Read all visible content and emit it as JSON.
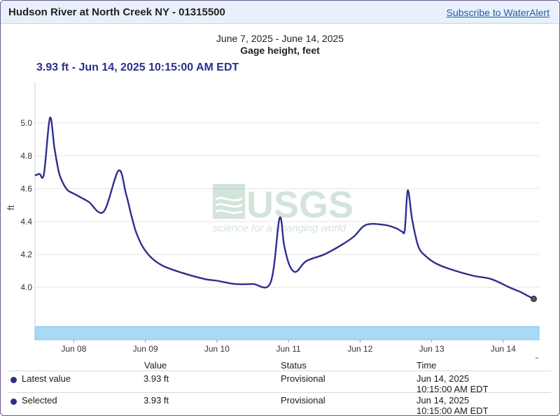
{
  "header": {
    "site_title": "Hudson River at North Creek NY - 01315500",
    "subscribe_label": "Subscribe to WaterAlert"
  },
  "tooltip": "3.93 ft - Jun 14, 2025 10:15:00 AM EDT",
  "watermark": {
    "logo": "USGS",
    "tagline": "science for a changing world"
  },
  "legend": {
    "headers": {
      "value": "Value",
      "status": "Status",
      "time": "Time"
    },
    "rows": [
      {
        "name": "Latest value",
        "value": "3.93 ft",
        "status": "Provisional",
        "time_line1": "Jun 14, 2025",
        "time_line2": "10:15:00 AM EDT"
      },
      {
        "name": "Selected",
        "value": "3.93 ft",
        "status": "Provisional",
        "time_line1": "Jun 14, 2025",
        "time_line2": "10:15:00 AM EDT"
      }
    ]
  },
  "colors": {
    "line": "#2e2e8f",
    "navigator": "#a9d9f5",
    "header_bg": "#e8f0fb",
    "grid": "#e3e3e3"
  },
  "chart_data": {
    "type": "line",
    "title": "June 7, 2025 - June 14, 2025",
    "subtitle": "Gage height, feet",
    "xlabel": "",
    "ylabel": "ft",
    "x_ticks": [
      "Jun 08",
      "Jun 09",
      "Jun 10",
      "Jun 11",
      "Jun 12",
      "Jun 13",
      "Jun 14"
    ],
    "y_ticks": [
      "4.0",
      "4.2",
      "4.4",
      "4.6",
      "4.8",
      "5.0"
    ],
    "ylim": [
      3.77,
      5.25
    ],
    "xlim": [
      "2025-06-07 11:00",
      "2025-06-14 12:00"
    ],
    "grid": true,
    "series": [
      {
        "name": "",
        "x": [
          "2025-06-07 11:00",
          "2025-06-07 12:30",
          "2025-06-07 14:00",
          "2025-06-07 16:00",
          "2025-06-07 17:30",
          "2025-06-07 19:00",
          "2025-06-07 20:30",
          "2025-06-07 22:00",
          "2025-06-08 00:00",
          "2025-06-08 02:00",
          "2025-06-08 05:00",
          "2025-06-08 10:00",
          "2025-06-08 15:00",
          "2025-06-08 17:30",
          "2025-06-08 19:00",
          "2025-06-08 20:00",
          "2025-06-08 21:00",
          "2025-06-08 23:00",
          "2025-06-09 02:00",
          "2025-06-09 06:00",
          "2025-06-09 12:00",
          "2025-06-09 20:00",
          "2025-06-10 00:00",
          "2025-06-10 06:00",
          "2025-06-10 12:00",
          "2025-06-10 18:00",
          "2025-06-10 21:00",
          "2025-06-10 22:30",
          "2025-06-11 00:00",
          "2025-06-11 01:30",
          "2025-06-11 03:00",
          "2025-06-11 06:00",
          "2025-06-11 12:00",
          "2025-06-11 18:00",
          "2025-06-11 22:00",
          "2025-06-12 02:00",
          "2025-06-12 08:00",
          "2025-06-12 12:00",
          "2025-06-12 14:00",
          "2025-06-12 15:00",
          "2025-06-12 16:00",
          "2025-06-12 17:30",
          "2025-06-12 19:30",
          "2025-06-12 22:00",
          "2025-06-13 02:00",
          "2025-06-13 08:00",
          "2025-06-13 14:00",
          "2025-06-13 20:00",
          "2025-06-14 02:00",
          "2025-06-14 06:00",
          "2025-06-14 08:00",
          "2025-06-14 10:15"
        ],
        "y": [
          4.68,
          4.69,
          4.69,
          5.03,
          4.85,
          4.7,
          4.63,
          4.59,
          4.57,
          4.55,
          4.52,
          4.46,
          4.71,
          4.57,
          4.46,
          4.39,
          4.33,
          4.25,
          4.18,
          4.13,
          4.09,
          4.05,
          4.04,
          4.02,
          4.02,
          4.03,
          4.42,
          4.26,
          4.15,
          4.1,
          4.1,
          4.16,
          4.2,
          4.26,
          4.31,
          4.38,
          4.38,
          4.36,
          4.34,
          4.35,
          4.59,
          4.41,
          4.25,
          4.19,
          4.14,
          4.1,
          4.07,
          4.05,
          4.0,
          3.97,
          3.95,
          3.93
        ]
      }
    ],
    "latest_marker": {
      "x": "2025-06-14 10:15",
      "y": 3.93
    }
  }
}
